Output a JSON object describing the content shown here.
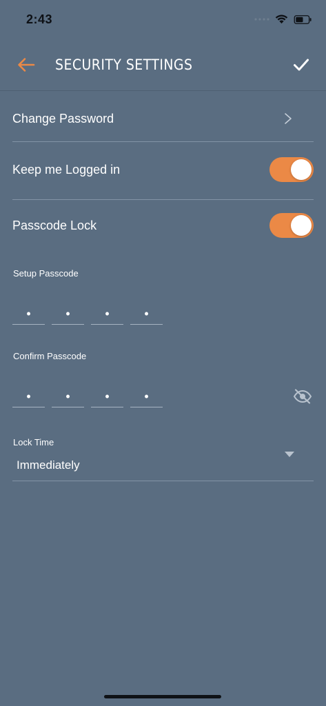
{
  "status_bar": {
    "time": "2:43",
    "icons": [
      "signal-icon",
      "wifi-icon",
      "battery-icon"
    ]
  },
  "header": {
    "title": "SECURITY SETTINGS",
    "back_icon": "arrow-left-icon",
    "confirm_icon": "checkmark-icon"
  },
  "settings": {
    "change_password": {
      "label": "Change Password",
      "icon": "chevron-right-icon"
    },
    "keep_logged_in": {
      "label": "Keep me Logged in",
      "enabled": true
    },
    "passcode_lock": {
      "label": "Passcode Lock",
      "enabled": true
    }
  },
  "setup_passcode": {
    "label": "Setup Passcode",
    "digits": [
      "•",
      "•",
      "•",
      "•"
    ]
  },
  "confirm_passcode": {
    "label": "Confirm Passcode",
    "digits": [
      "•",
      "•",
      "•",
      "•"
    ],
    "visibility_icon": "eye-off-icon"
  },
  "lock_time": {
    "label": "Lock Time",
    "value": "Immediately",
    "icon": "dropdown-arrow-icon"
  },
  "colors": {
    "background": "#5a6d81",
    "accent": "#eb8946",
    "text": "#ffffff",
    "divider": "#8394a6"
  }
}
